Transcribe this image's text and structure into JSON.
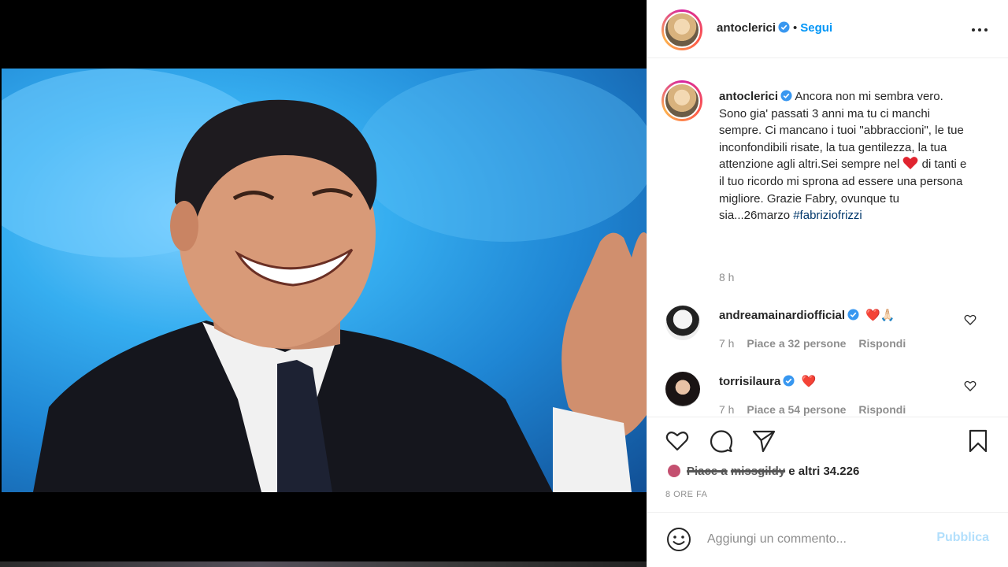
{
  "post": {
    "username": "antoclerici",
    "separator": "•",
    "follow_label": "Segui",
    "image_alt": "",
    "caption_username": "antoclerici",
    "caption_part1": "Ancora non mi sembra vero. Sono gia' passati 3 anni ma tu ci manchi sempre. Ci mancano i tuoi \"abbraccioni\", le tue inconfondibili risate, la tua gentilezza, la tua attenzione agli altri.Sei sempre nel ",
    "caption_part2": " di tanti e il tuo ricordo mi sprona ad essere una persona migliore. Grazie Fabry, ovunque tu sia...26marzo",
    "hashtag": "#fabriziofrizzi",
    "caption_time": "8 h"
  },
  "comments": [
    {
      "username": "andreamainardiofficial",
      "emoji": "❤️🙏🏻",
      "time": "7 h",
      "likes": "Piace a 32 persone",
      "reply": "Rispondi"
    },
    {
      "username": "torrisilaura",
      "emoji": "❤️",
      "time": "7 h",
      "likes": "Piace a 54 persone",
      "reply": "Rispondi"
    }
  ],
  "likes_bar": {
    "liked_by_prefix": "Piace a",
    "liked_by_user": "missgildy",
    "others": "e altri 34.226",
    "date": "8 ORE FA"
  },
  "composer": {
    "placeholder": "Aggiungi un commento...",
    "publish_label": "Pubblica"
  },
  "colors": {
    "accent": "#0095f6",
    "heart": "#ed4956",
    "verified": "#3897f0",
    "muted": "#8e8e8e"
  },
  "icons": [
    "verified-icon",
    "more-options-icon",
    "like-icon",
    "comment-icon",
    "share-icon",
    "save-icon",
    "emoji-icon"
  ]
}
